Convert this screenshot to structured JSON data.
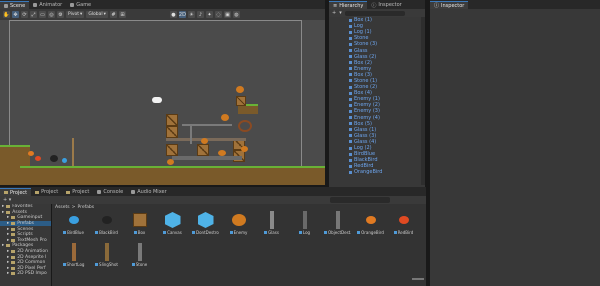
{
  "scene_tabs": [
    "Scene",
    "Animator",
    "Game"
  ],
  "toolbar": {
    "pivot": "Pivot",
    "global": "Global"
  },
  "hierarchy_tabs": [
    "Hierarchy",
    "Inspector"
  ],
  "inspector_right_tab": "Inspector",
  "hierarchy_items": [
    "Box (1)",
    "Log",
    "Log (1)",
    "Stone",
    "Stone (3)",
    "Glass",
    "Glass (2)",
    "Box (2)",
    "Enemy",
    "Box (3)",
    "Stone (1)",
    "Stone (2)",
    "Box (4)",
    "Enemy (1)",
    "Enemy (2)",
    "Enemy (3)",
    "Enemy (4)",
    "Box (5)",
    "Glass (1)",
    "Glass (3)",
    "Glass (4)",
    "Log (2)",
    "BirdBlue",
    "BlackBird",
    "RedBird",
    "OrangeBird"
  ],
  "project_tabs": [
    "Project",
    "Project",
    "Project",
    "Console",
    "Audio Mixer"
  ],
  "tree": [
    {
      "label": "Favorites",
      "level": 0
    },
    {
      "label": "Assets",
      "level": 0
    },
    {
      "label": "Gameinput",
      "level": 1
    },
    {
      "label": "Prefabs",
      "level": 1
    },
    {
      "label": "Scenes",
      "level": 1
    },
    {
      "label": "Scripts",
      "level": 1
    },
    {
      "label": "TextMesh Pro",
      "level": 1
    },
    {
      "label": "Packages",
      "level": 0
    },
    {
      "label": "2D Animation",
      "level": 1
    },
    {
      "label": "2D Aseprite I",
      "level": 1
    },
    {
      "label": "2D Common",
      "level": 1
    },
    {
      "label": "2D Pixel Perf",
      "level": 1
    },
    {
      "label": "2D PSD Impo",
      "level": 1
    }
  ],
  "breadcrumb": [
    "Assets",
    "Prefabs"
  ],
  "assets_row1": [
    "BirdBlue",
    "BlackBird",
    "Box",
    "Canvas",
    "DontDestro...",
    "Enemy",
    "Glass",
    "Log",
    "ObjectDest...",
    "OrangeBird",
    "RedBird"
  ],
  "assets_row2": [
    "ShortLog",
    "SlingShot",
    "Stone"
  ],
  "colors": {
    "accent": "#3a79bb",
    "hierarchy_text": "#6ea6ef"
  }
}
